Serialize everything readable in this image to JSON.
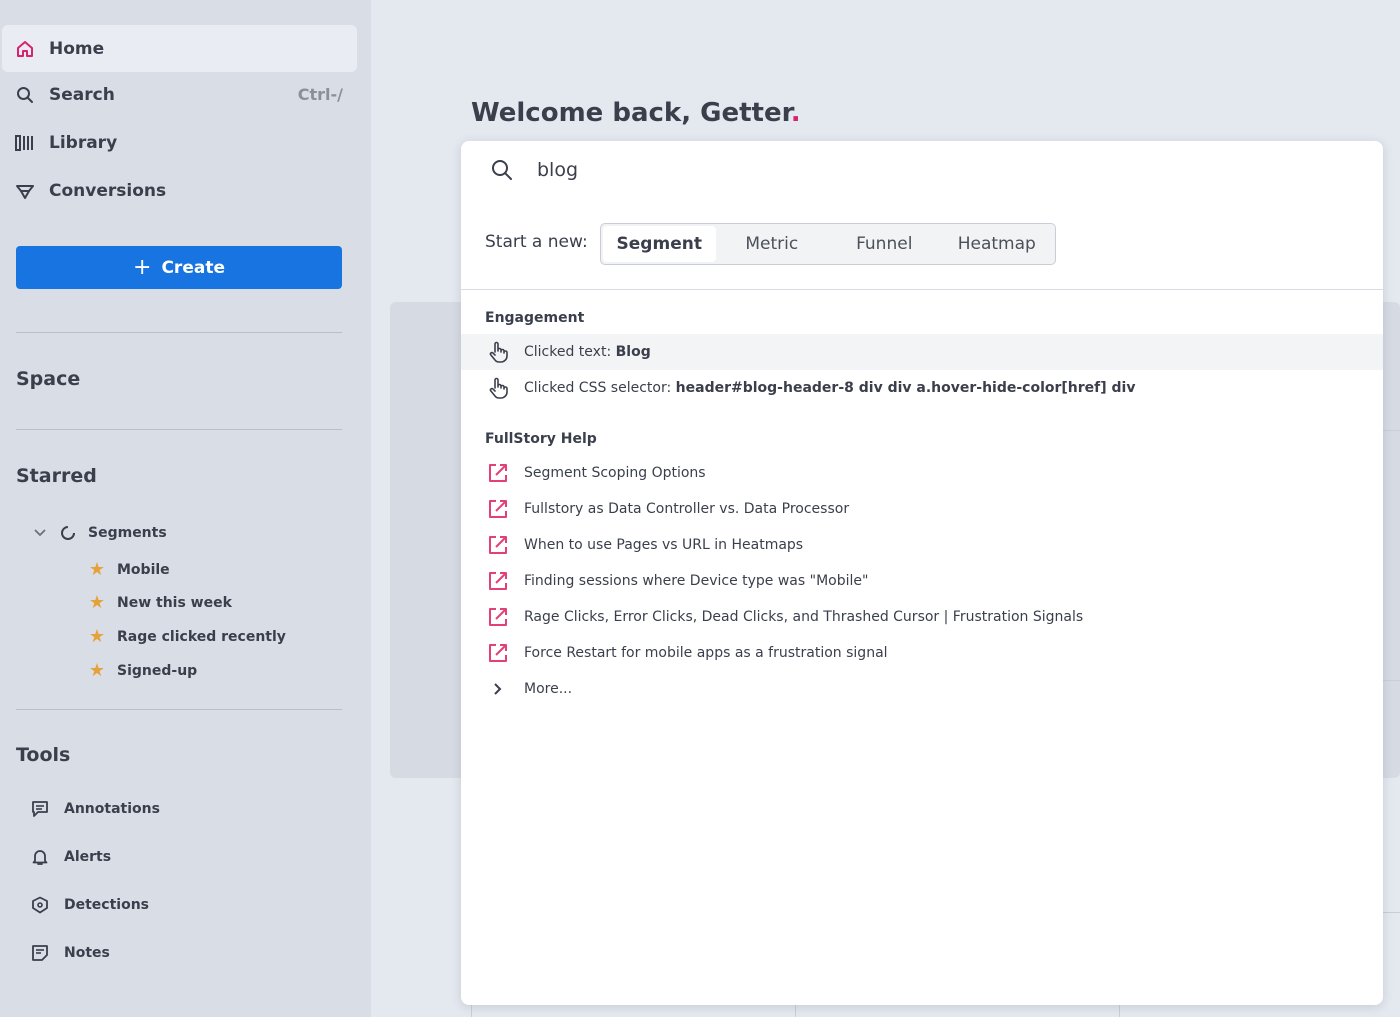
{
  "sidebar": {
    "nav": [
      {
        "label": "Home",
        "icon": "home-icon"
      },
      {
        "label": "Search",
        "icon": "search-icon",
        "shortcut": "Ctrl-/"
      },
      {
        "label": "Library",
        "icon": "library-icon"
      },
      {
        "label": "Conversions",
        "icon": "conversions-icon"
      }
    ],
    "create_label": "Create",
    "space_title": "Space",
    "starred_title": "Starred",
    "starred_group": "Segments",
    "starred_items": [
      "Mobile",
      "New this week",
      "Rage clicked recently",
      "Signed-up"
    ],
    "tools_title": "Tools",
    "tools": [
      "Annotations",
      "Alerts",
      "Detections",
      "Notes"
    ]
  },
  "main": {
    "welcome": "Welcome back, Getter",
    "welcome_dot": "."
  },
  "search": {
    "query": "blog",
    "start_label": "Start a new:",
    "options": [
      "Segment",
      "Metric",
      "Funnel",
      "Heatmap"
    ],
    "selected_option": "Segment",
    "groups": [
      {
        "title": "Engagement",
        "results": [
          {
            "prefix": "Clicked text: ",
            "value": "Blog",
            "icon": "pointer-hand-icon"
          },
          {
            "prefix": "Clicked CSS selector: ",
            "value": "header#blog-header-8 div div a.hover-hide-color[href] div",
            "icon": "pointer-hand-icon"
          }
        ]
      },
      {
        "title": "FullStory Help",
        "results": [
          {
            "text": "Segment Scoping Options",
            "icon": "external-link-icon"
          },
          {
            "text": "Fullstory as Data Controller vs. Data Processor",
            "icon": "external-link-icon"
          },
          {
            "text": "When to use Pages vs URL in Heatmaps",
            "icon": "external-link-icon"
          },
          {
            "text": "Finding sessions where Device type was \"Mobile\"",
            "icon": "external-link-icon"
          },
          {
            "text": "Rage Clicks, Error Clicks, Dead Clicks, and Thrashed Cursor | Frustration Signals",
            "icon": "external-link-icon"
          },
          {
            "text": "Force Restart for mobile apps as a frustration signal",
            "icon": "external-link-icon"
          }
        ],
        "more_label": "More..."
      }
    ]
  },
  "colors": {
    "accent": "#1774e0",
    "brand_pink": "#d6246e",
    "star": "#e5a23a",
    "sidebar_bg": "#d9dde5",
    "page_bg": "#e4e8ef"
  }
}
